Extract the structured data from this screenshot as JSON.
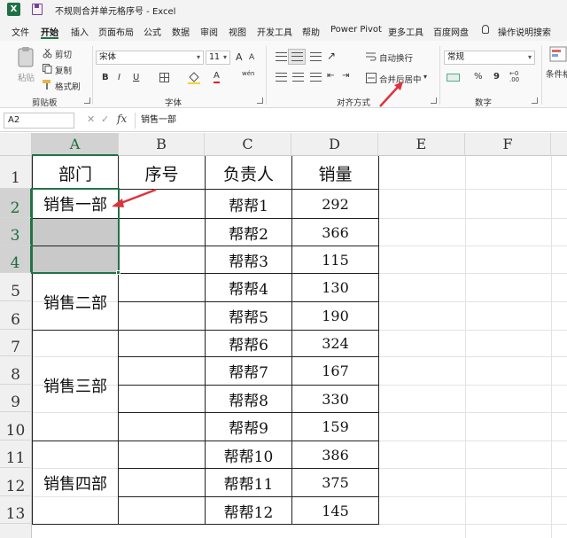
{
  "title": {
    "text": "不规则合并单元格序号  -  Excel",
    "logo": "X"
  },
  "tabs": [
    "文件",
    "开始",
    "插入",
    "页面布局",
    "公式",
    "数据",
    "审阅",
    "视图",
    "开发工具",
    "帮助",
    "Power Pivot",
    "更多工具",
    "百度网盘",
    "操作说明搜索"
  ],
  "ribbon": {
    "clipboard": {
      "paste": "粘贴",
      "cut": "剪切",
      "copy": "复制",
      "format_painter": "格式刷",
      "group": "剪贴板"
    },
    "font": {
      "name": "宋体",
      "size": "11",
      "bold": "B",
      "italic": "I",
      "underline": "U",
      "font_color": "A",
      "phonetic": "wén",
      "group": "字体",
      "grow": "A",
      "shrink": "A"
    },
    "alignment": {
      "wrap": "自动换行",
      "merge": "合并后居中",
      "group": "对齐方式"
    },
    "number": {
      "format": "常规",
      "percent": "%",
      "comma": "9",
      "group": "数字"
    },
    "styles": {
      "conditional": "条件格"
    }
  },
  "formula_bar": {
    "name_box": "A2",
    "cancel": "✕",
    "enter": "✓",
    "fx": "fx",
    "content": "销售一部"
  },
  "columns": [
    "A",
    "B",
    "C",
    "D",
    "E",
    "F"
  ],
  "rows": [
    "1",
    "2",
    "3",
    "4",
    "5",
    "6",
    "7",
    "8",
    "9",
    "10",
    "11",
    "12",
    "13"
  ],
  "sheet": {
    "headers": [
      "部门",
      "序号",
      "负责人",
      "销量"
    ],
    "departments": [
      "销售一部",
      "销售二部",
      "销售三部",
      "销售四部"
    ],
    "people": [
      "帮帮1",
      "帮帮2",
      "帮帮3",
      "帮帮4",
      "帮帮5",
      "帮帮6",
      "帮帮7",
      "帮帮8",
      "帮帮9",
      "帮帮10",
      "帮帮11",
      "帮帮12"
    ],
    "sales": [
      "292",
      "366",
      "115",
      "130",
      "190",
      "324",
      "167",
      "330",
      "159",
      "386",
      "375",
      "145"
    ]
  },
  "colors": {
    "excel_green": "#217346",
    "annotation_red": "#e0323c",
    "selection_gray": "#c9c9c9"
  }
}
